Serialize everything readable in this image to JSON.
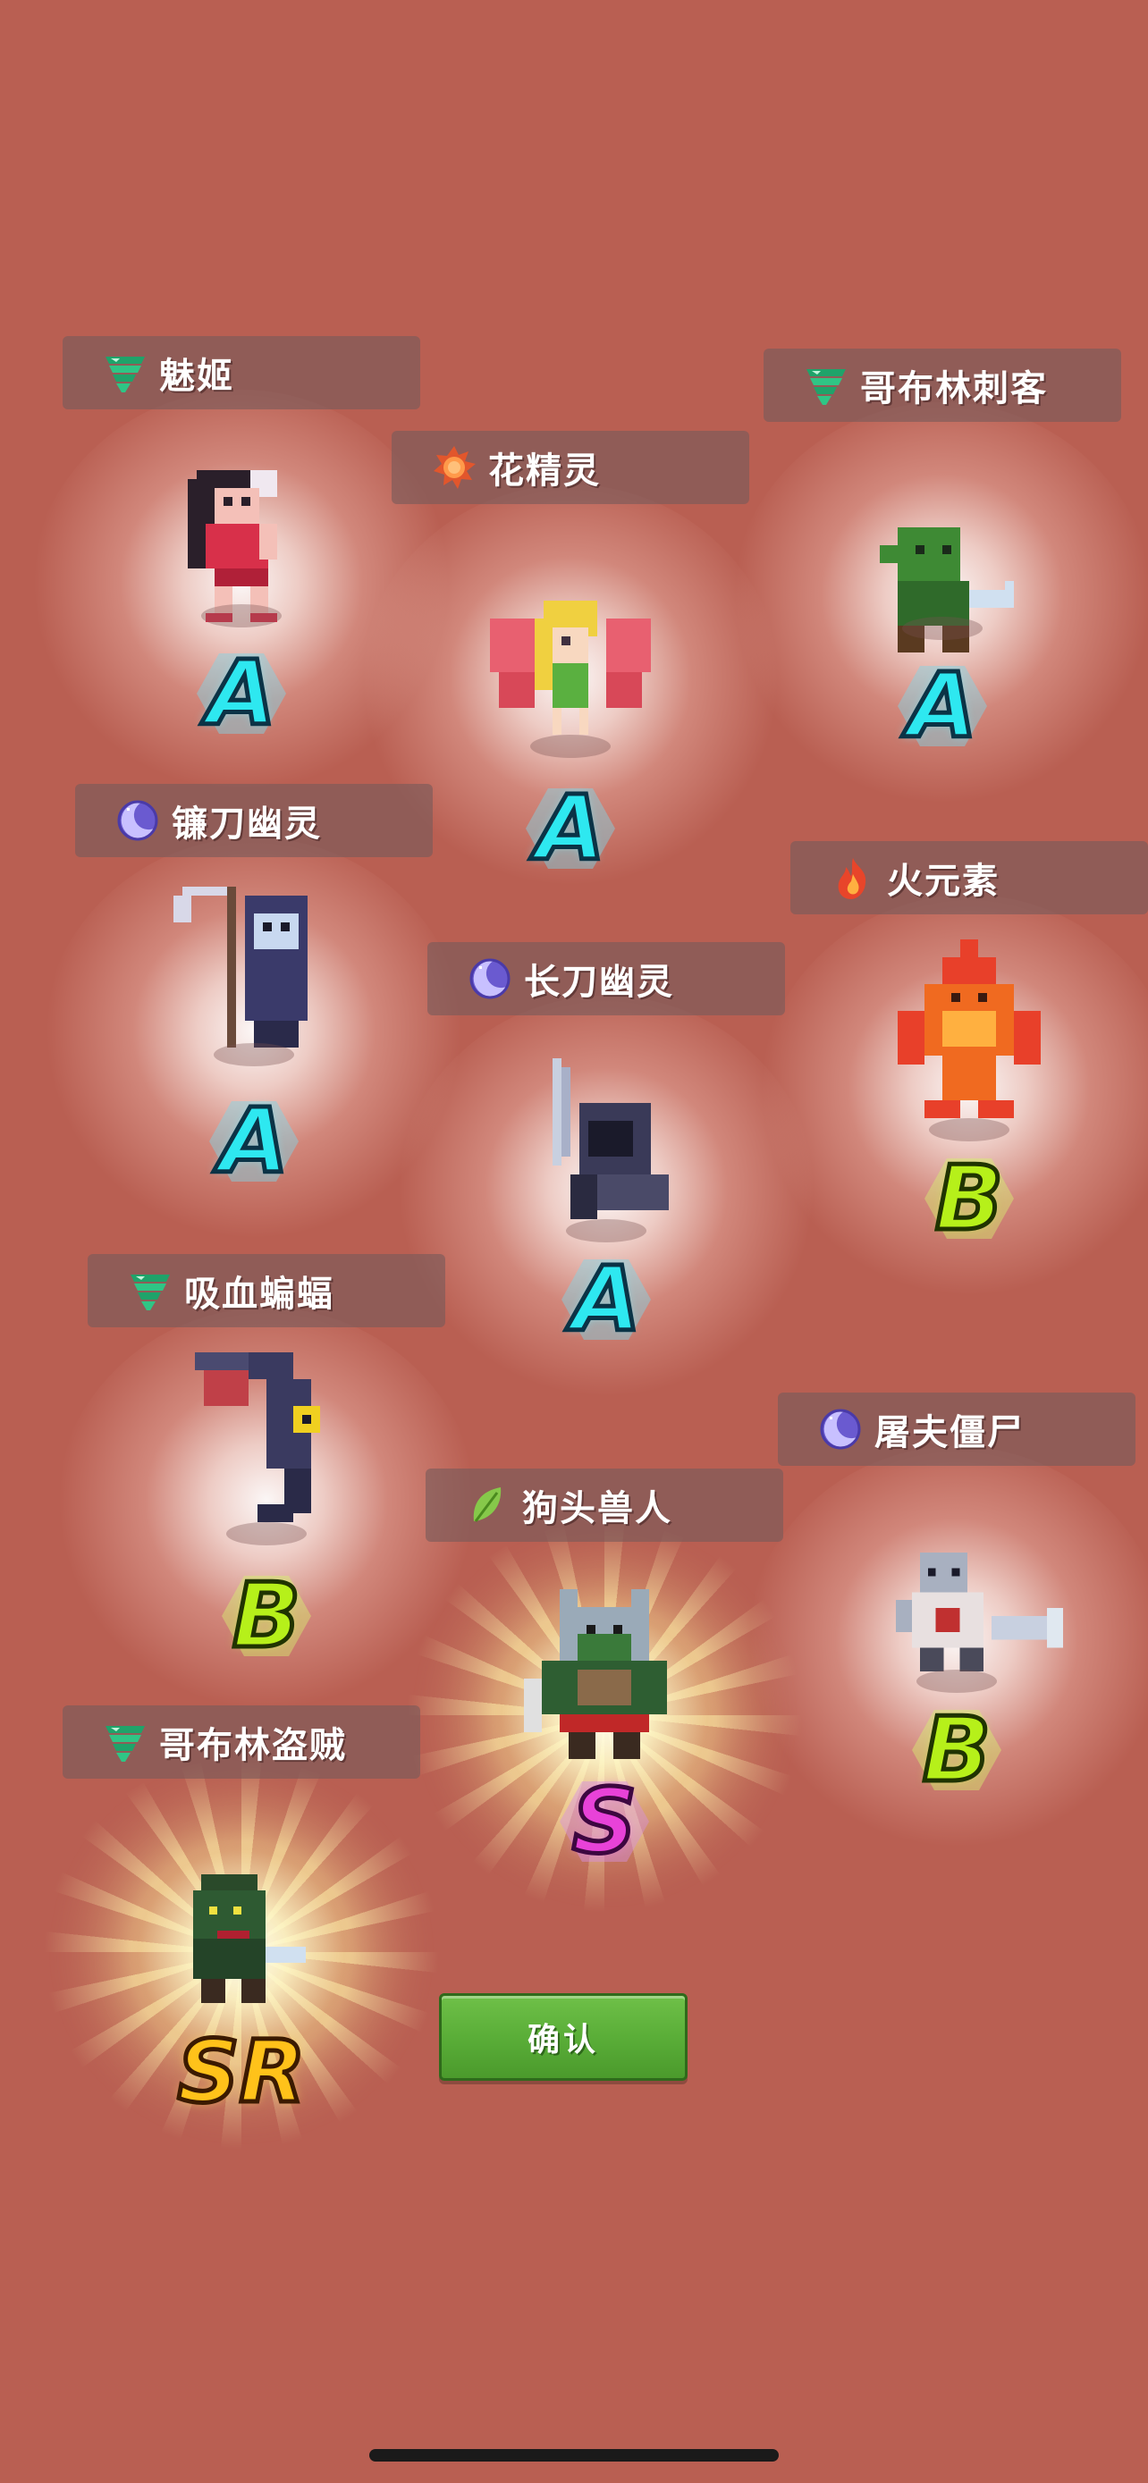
{
  "background_color": "#b95f52",
  "monsters": [
    {
      "name": "魅姬",
      "element_icon": "wind-icon",
      "rank": "A"
    },
    {
      "name": "花精灵",
      "element_icon": "sun-icon",
      "rank": "A"
    },
    {
      "name": "哥布林刺客",
      "element_icon": "wind-icon",
      "rank": "A"
    },
    {
      "name": "镰刀幽灵",
      "element_icon": "moon-icon",
      "rank": "A"
    },
    {
      "name": "火元素",
      "element_icon": "fire-icon",
      "rank": "B"
    },
    {
      "name": "长刀幽灵",
      "element_icon": "moon-icon",
      "rank": "A"
    },
    {
      "name": "吸血蝙蝠",
      "element_icon": "wind-icon",
      "rank": "B"
    },
    {
      "name": "屠夫僵尸",
      "element_icon": "moon-icon",
      "rank": "B"
    },
    {
      "name": "狗头兽人",
      "element_icon": "leaf-icon",
      "rank": "S"
    },
    {
      "name": "哥布林盗贼",
      "element_icon": "wind-icon",
      "rank": "SR"
    }
  ],
  "confirm_button": {
    "label": "确认",
    "color": "#5aae38"
  }
}
